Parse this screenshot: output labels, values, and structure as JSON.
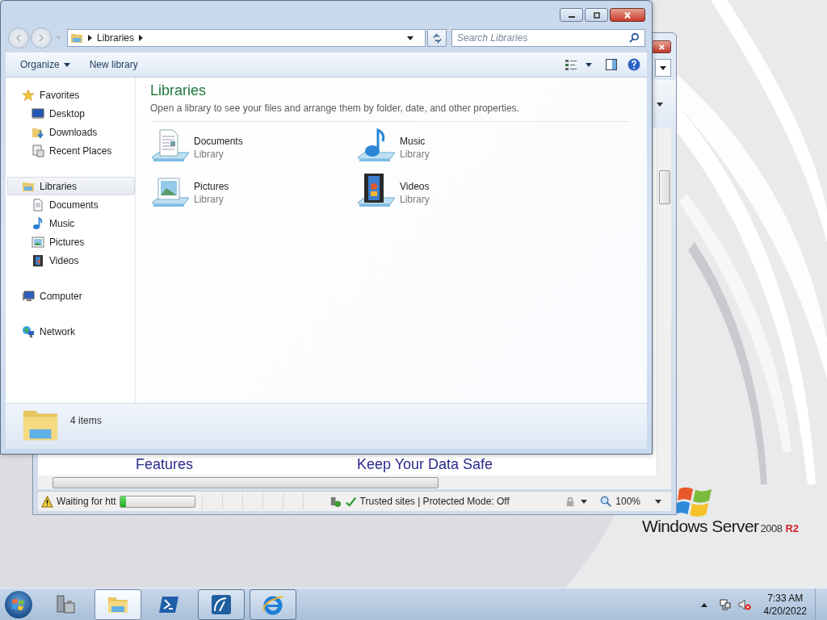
{
  "explorer": {
    "address": {
      "crumbs": [
        "Libraries"
      ]
    },
    "search": {
      "placeholder": "Search Libraries"
    },
    "toolbar": [
      {
        "label": "Organize",
        "dropdown": true
      },
      {
        "label": "New library",
        "dropdown": false
      }
    ],
    "nav": [
      {
        "label": "Favorites",
        "kind": "star",
        "selected": false,
        "children": [
          {
            "label": "Desktop",
            "kind": "desktop",
            "selected": false
          },
          {
            "label": "Downloads",
            "kind": "downloads",
            "selected": false
          },
          {
            "label": "Recent Places",
            "kind": "recent",
            "selected": false
          }
        ]
      },
      {
        "label": "Libraries",
        "kind": "library",
        "selected": true,
        "children": [
          {
            "label": "Documents",
            "kind": "documents",
            "selected": false
          },
          {
            "label": "Music",
            "kind": "music",
            "selected": false
          },
          {
            "label": "Pictures",
            "kind": "pictures",
            "selected": false
          },
          {
            "label": "Videos",
            "kind": "videos",
            "selected": false
          }
        ]
      },
      {
        "label": "Computer",
        "kind": "computer",
        "selected": false
      },
      {
        "label": "Network",
        "kind": "network",
        "selected": false
      }
    ],
    "content": {
      "title": "Libraries",
      "description": "Open a library to see your files and arrange them by folder, date, and other properties.",
      "libraries": [
        {
          "name": "Documents",
          "type": "Library",
          "kind": "documents"
        },
        {
          "name": "Music",
          "type": "Library",
          "kind": "music"
        },
        {
          "name": "Pictures",
          "type": "Library",
          "kind": "pictures"
        },
        {
          "name": "Videos",
          "type": "Library",
          "kind": "videos"
        }
      ]
    },
    "details": {
      "count": "4 items"
    }
  },
  "browser": {
    "headings": [
      "Features",
      "Keep Your Data Safe"
    ],
    "status": {
      "text": "Waiting for htt",
      "level": 0.08,
      "zone": "Trusted sites | Protected Mode: Off",
      "zoom": "100%"
    }
  },
  "logo": {
    "name": "Windows Server",
    "version": "2008",
    "edition": "R2"
  },
  "taskbar": {
    "buttons": [
      {
        "kind": "server",
        "running": false,
        "active": false
      },
      {
        "kind": "explorer",
        "running": true,
        "active": true
      },
      {
        "kind": "powershell",
        "running": false,
        "active": false
      },
      {
        "kind": "gauge",
        "running": true,
        "active": false
      },
      {
        "kind": "ie",
        "running": true,
        "active": false
      }
    ],
    "clock": {
      "time": "7:33 AM",
      "date": "4/20/2022"
    }
  }
}
